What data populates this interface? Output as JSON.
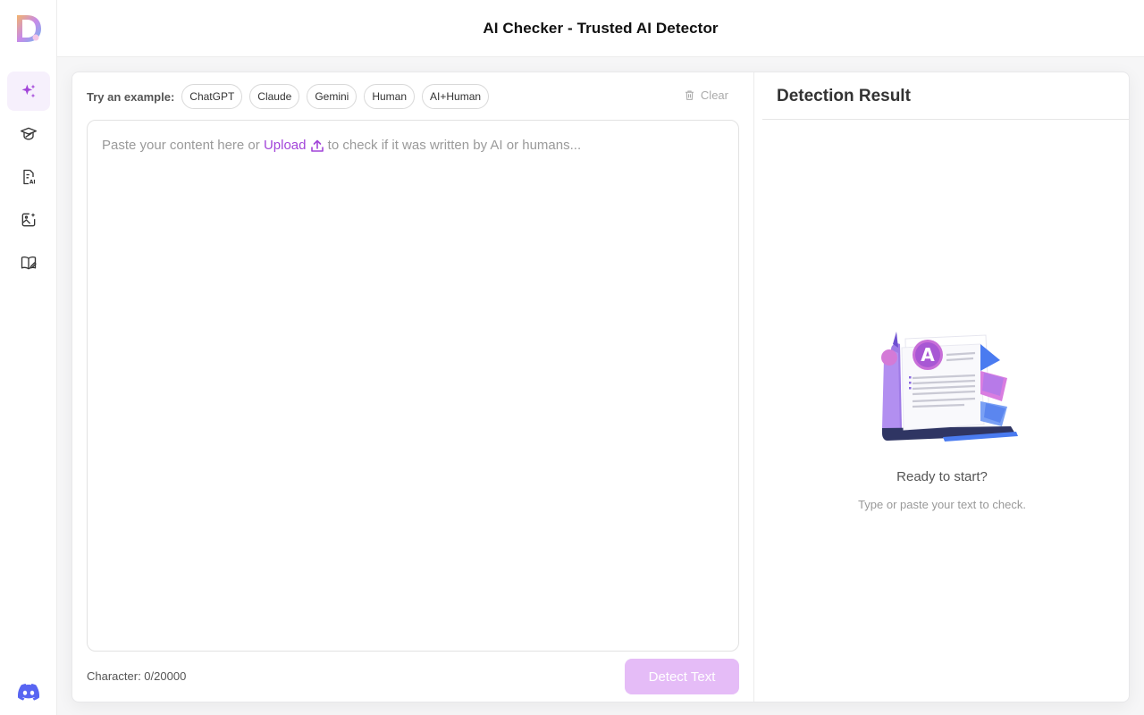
{
  "app": {
    "title": "AI Checker - Trusted AI Detector",
    "accent_color": "#a245d9"
  },
  "sidebar": {
    "logo": "D",
    "items": [
      {
        "icon": "sparkles-icon",
        "active": true
      },
      {
        "icon": "graduation-cap-icon",
        "active": false
      },
      {
        "icon": "ai-document-icon",
        "active": false
      },
      {
        "icon": "image-sparkle-icon",
        "active": false
      },
      {
        "icon": "book-edit-icon",
        "active": false
      }
    ],
    "footer_icon": "discord-icon"
  },
  "input_panel": {
    "examples_label": "Try an example:",
    "examples": [
      "ChatGPT",
      "Claude",
      "Gemini",
      "Human",
      "AI+Human"
    ],
    "clear_label": "Clear",
    "placeholder_before": "Paste your content here or",
    "upload_label": "Upload",
    "placeholder_after": "to check if it was written by AI or humans...",
    "character_count": "Character: 0/20000",
    "detect_button": "Detect Text"
  },
  "result_panel": {
    "title": "Detection Result",
    "ready_title": "Ready to start?",
    "ready_hint": "Type or paste your text to check."
  }
}
